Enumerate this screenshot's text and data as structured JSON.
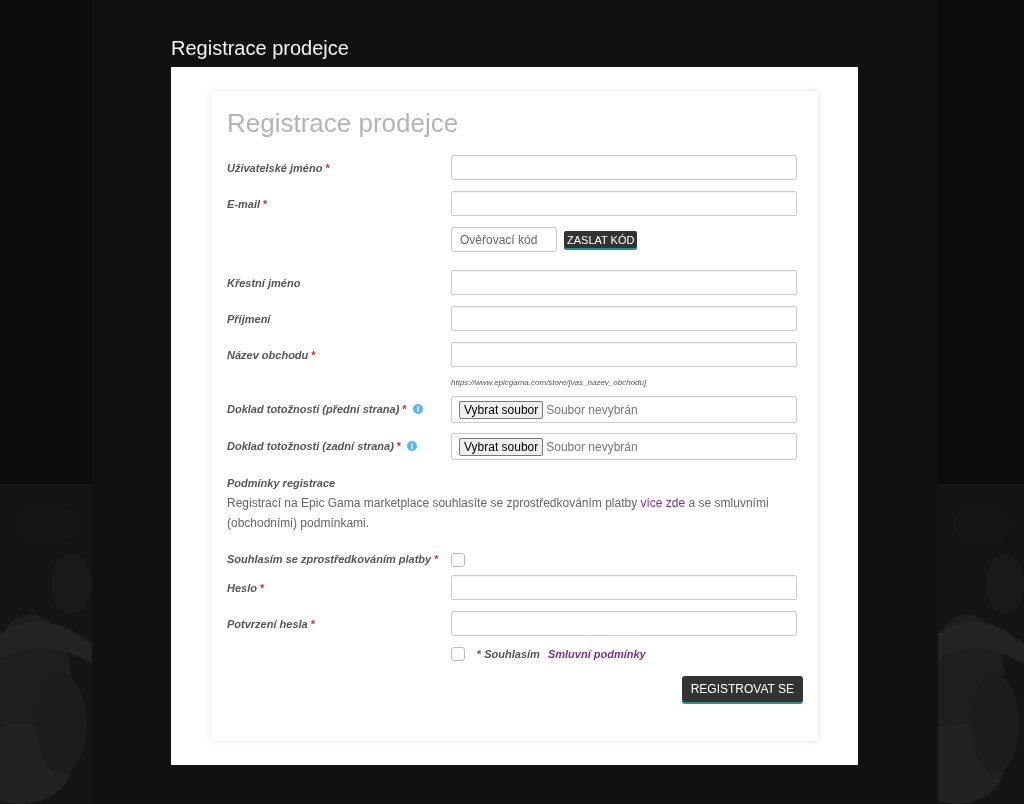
{
  "page_title": "Registrace prodejce",
  "form": {
    "title": "Registrace prodejce",
    "rows": [
      {
        "kind": "text",
        "label": "Uživatelské jméno",
        "required_mark": "*"
      },
      {
        "kind": "text",
        "label": "E-mail",
        "required_mark": "*"
      },
      {
        "kind": "verify",
        "placeholder": "Ověřovací kód",
        "button": "ZASLAT KÓD"
      },
      {
        "kind": "text",
        "label": "Křestní jméno"
      },
      {
        "kind": "text",
        "label": "Příjmení"
      },
      {
        "kind": "text",
        "label": "Název obchodu",
        "required_mark": "*"
      },
      {
        "kind": "hint",
        "text": "https://www.epicgama.com/store/[vas_nazev_obchodu]"
      },
      {
        "kind": "file",
        "label": "Doklad totožnosti (přední strana)",
        "required_mark": "*",
        "button": "Vybrat soubor",
        "status": "Soubor nevybrán"
      },
      {
        "kind": "file",
        "label": "Doklad totožnosti (zadní strana)",
        "required_mark": "*",
        "button": "Vybrat soubor",
        "status": "Soubor nevybrán"
      },
      {
        "kind": "section",
        "label": "Podmínky registrace"
      },
      {
        "kind": "paragraph",
        "before": "Registrací na Epic Gama marketplace souhlasíte se zprostředkováním platby ",
        "link": "více zde",
        "after": " a se smluvními (obchodními) podmínkami."
      },
      {
        "kind": "checkbox",
        "label": "Souhlasím se zprostředkováním platby",
        "required_mark": "*",
        "checked": false
      },
      {
        "kind": "password",
        "label": "Heslo",
        "required_mark": "*"
      },
      {
        "kind": "password",
        "label": "Potvrzení hesla",
        "required_mark": "*"
      },
      {
        "kind": "terms",
        "required_mark": "*",
        "label": "Souhlasím",
        "link": "Smluvní podmínky",
        "checked": false
      }
    ],
    "submit": "REGISTROVAT SE"
  }
}
